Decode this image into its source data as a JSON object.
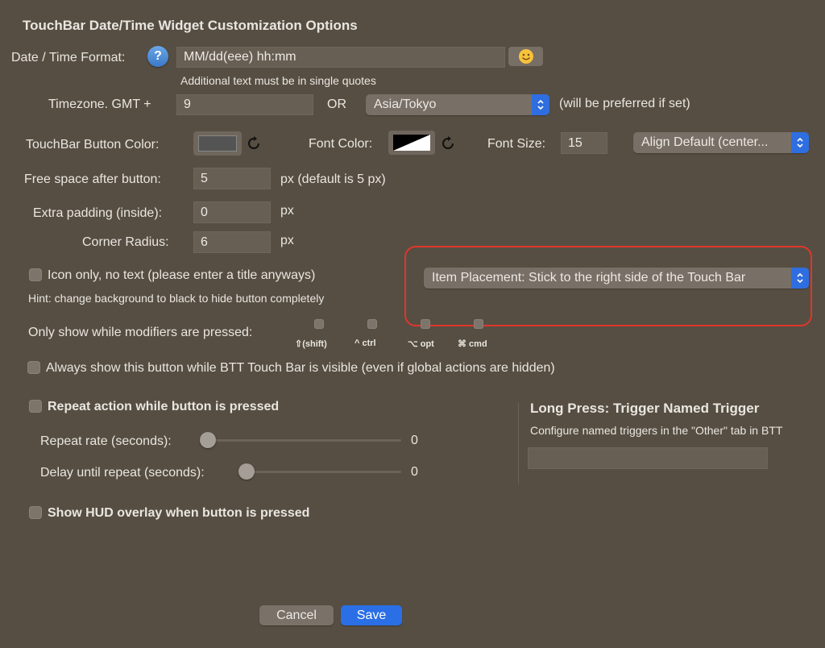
{
  "title": "TouchBar Date/Time Widget Customization Options",
  "format": {
    "label": "Date / Time Format:",
    "help_icon": "?",
    "value": "MM/dd(eee) hh:mm",
    "emoji_icon": "smiley-emoji-icon",
    "hint": "Additional text must be in single quotes"
  },
  "timezone": {
    "label": "Timezone. GMT +",
    "value": "9",
    "or_label": "OR",
    "select_value": "Asia/Tokyo",
    "note": "(will be preferred if set)"
  },
  "colors": {
    "button_color_label": "TouchBar Button Color:",
    "button_color": "#545454",
    "font_color_label": "Font Color:",
    "font_size_label": "Font Size:",
    "font_size_value": "15",
    "align_value": "Align Default (center..."
  },
  "spacing": {
    "free_space_label": "Free space after button:",
    "free_space_value": "5",
    "free_space_unit": "px (default is 5 px)",
    "padding_label": "Extra padding (inside):",
    "padding_value": "0",
    "padding_unit": "px",
    "radius_label": "Corner Radius:",
    "radius_value": "6",
    "radius_unit": "px"
  },
  "icon_only": {
    "label": "Icon only, no text (please enter a title anyways)",
    "hint": "Hint: change background to black to hide button completely"
  },
  "placement": {
    "value": "Item Placement: Stick to the right side of the Touch Bar",
    "highlight_color": "#e0362c"
  },
  "modifiers": {
    "label": "Only show while modifiers are pressed:",
    "items": [
      "⇧(shift)",
      "^ ctrl",
      "⌥ opt",
      "⌘ cmd"
    ]
  },
  "always_show": {
    "label": "Always show this button while BTT Touch Bar is visible (even if global actions are hidden)"
  },
  "repeat": {
    "label": "Repeat action while button is pressed",
    "rate_label": "Repeat rate (seconds):",
    "rate_value": "0",
    "delay_label": "Delay until repeat (seconds):",
    "delay_value": "0"
  },
  "long_press": {
    "title": "Long Press: Trigger Named Trigger",
    "hint": "Configure named triggers in the \"Other\" tab in BTT",
    "value": ""
  },
  "hud": {
    "label": "Show HUD overlay when button is pressed"
  },
  "buttons": {
    "cancel": "Cancel",
    "save": "Save",
    "accent": "#2b6fe6"
  }
}
